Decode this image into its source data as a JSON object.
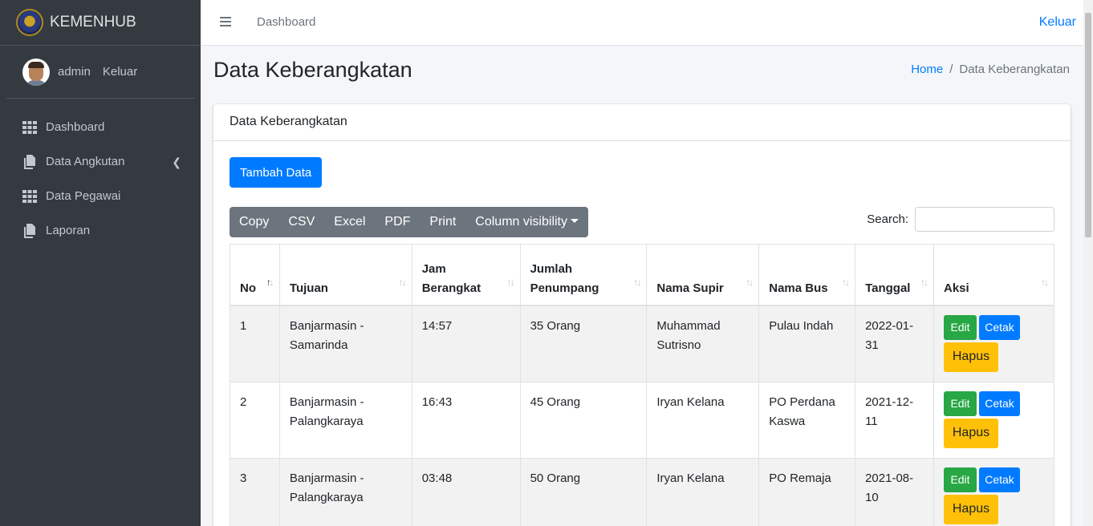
{
  "brand": {
    "name": "KEMENHUB"
  },
  "user": {
    "name": "admin",
    "logout": "Keluar"
  },
  "sidebar": {
    "items": [
      {
        "label": "Dashboard",
        "icon": "grid-icon"
      },
      {
        "label": "Data Angkutan",
        "icon": "copy-icon"
      },
      {
        "label": "Data Pegawai",
        "icon": "grid-icon"
      },
      {
        "label": "Laporan",
        "icon": "copy-icon"
      }
    ]
  },
  "topbar": {
    "link": "Dashboard",
    "logout": "Keluar"
  },
  "page": {
    "title": "Data Keberangkatan",
    "breadcrumb": {
      "home": "Home",
      "sep": "/",
      "current": "Data Keberangkatan"
    }
  },
  "card": {
    "header": "Data Keberangkatan",
    "add_button": "Tambah Data",
    "export_buttons": [
      "Copy",
      "CSV",
      "Excel",
      "PDF",
      "Print"
    ],
    "column_visibility": "Column visibility",
    "search_label": "Search:",
    "search_value": ""
  },
  "table": {
    "headers": [
      {
        "l1": "",
        "l2": "No"
      },
      {
        "l1": "",
        "l2": "Tujuan"
      },
      {
        "l1": "Jam",
        "l2": "Berangkat"
      },
      {
        "l1": "Jumlah",
        "l2": "Penumpang"
      },
      {
        "l1": "",
        "l2": "Nama Supir"
      },
      {
        "l1": "",
        "l2": "Nama Bus"
      },
      {
        "l1": "",
        "l2": "Tanggal"
      },
      {
        "l1": "",
        "l2": "Aksi"
      }
    ],
    "rows": [
      {
        "no": "1",
        "tujuan_l1": "Banjarmasin -",
        "tujuan_l2": "Samarinda",
        "jam": "14:57",
        "jumlah": "35 Orang",
        "supir_l1": "Muhammad",
        "supir_l2": "Sutrisno",
        "bus_l1": "Pulau Indah",
        "bus_l2": "",
        "tgl_l1": "2022-01-",
        "tgl_l2": "31"
      },
      {
        "no": "2",
        "tujuan_l1": "Banjarmasin -",
        "tujuan_l2": "Palangkaraya",
        "jam": "16:43",
        "jumlah": "45 Orang",
        "supir_l1": "Iryan Kelana",
        "supir_l2": "",
        "bus_l1": "PO Perdana",
        "bus_l2": "Kaswa",
        "tgl_l1": "2021-12-",
        "tgl_l2": "11"
      },
      {
        "no": "3",
        "tujuan_l1": "Banjarmasin -",
        "tujuan_l2": "Palangkaraya",
        "jam": "03:48",
        "jumlah": "50 Orang",
        "supir_l1": "Iryan Kelana",
        "supir_l2": "",
        "bus_l1": "PO Remaja",
        "bus_l2": "",
        "tgl_l1": "2021-08-",
        "tgl_l2": "10"
      }
    ],
    "actions": {
      "edit": "Edit",
      "cetak": "Cetak",
      "hapus": "Hapus"
    }
  },
  "colors": {
    "sidebar": "#343a40",
    "primary": "#007bff",
    "success": "#28a745",
    "warning": "#ffc107",
    "secondary": "#6c757d"
  }
}
